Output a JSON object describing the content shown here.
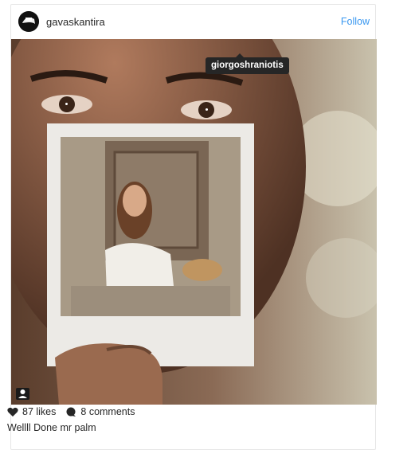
{
  "post": {
    "username": "gavaskantira",
    "follow_label": "Follow",
    "tagged_user": "giorgoshraniotis",
    "likes": "87 likes",
    "comments": "8 comments",
    "caption": "Wellll Done mr palm"
  },
  "icons": {
    "avatar": "profile-avatar",
    "tag": "user-tag-icon",
    "like": "heart-icon",
    "comment": "comment-bubble-icon"
  },
  "colors": {
    "link": "#3897f0",
    "text": "#262626"
  }
}
